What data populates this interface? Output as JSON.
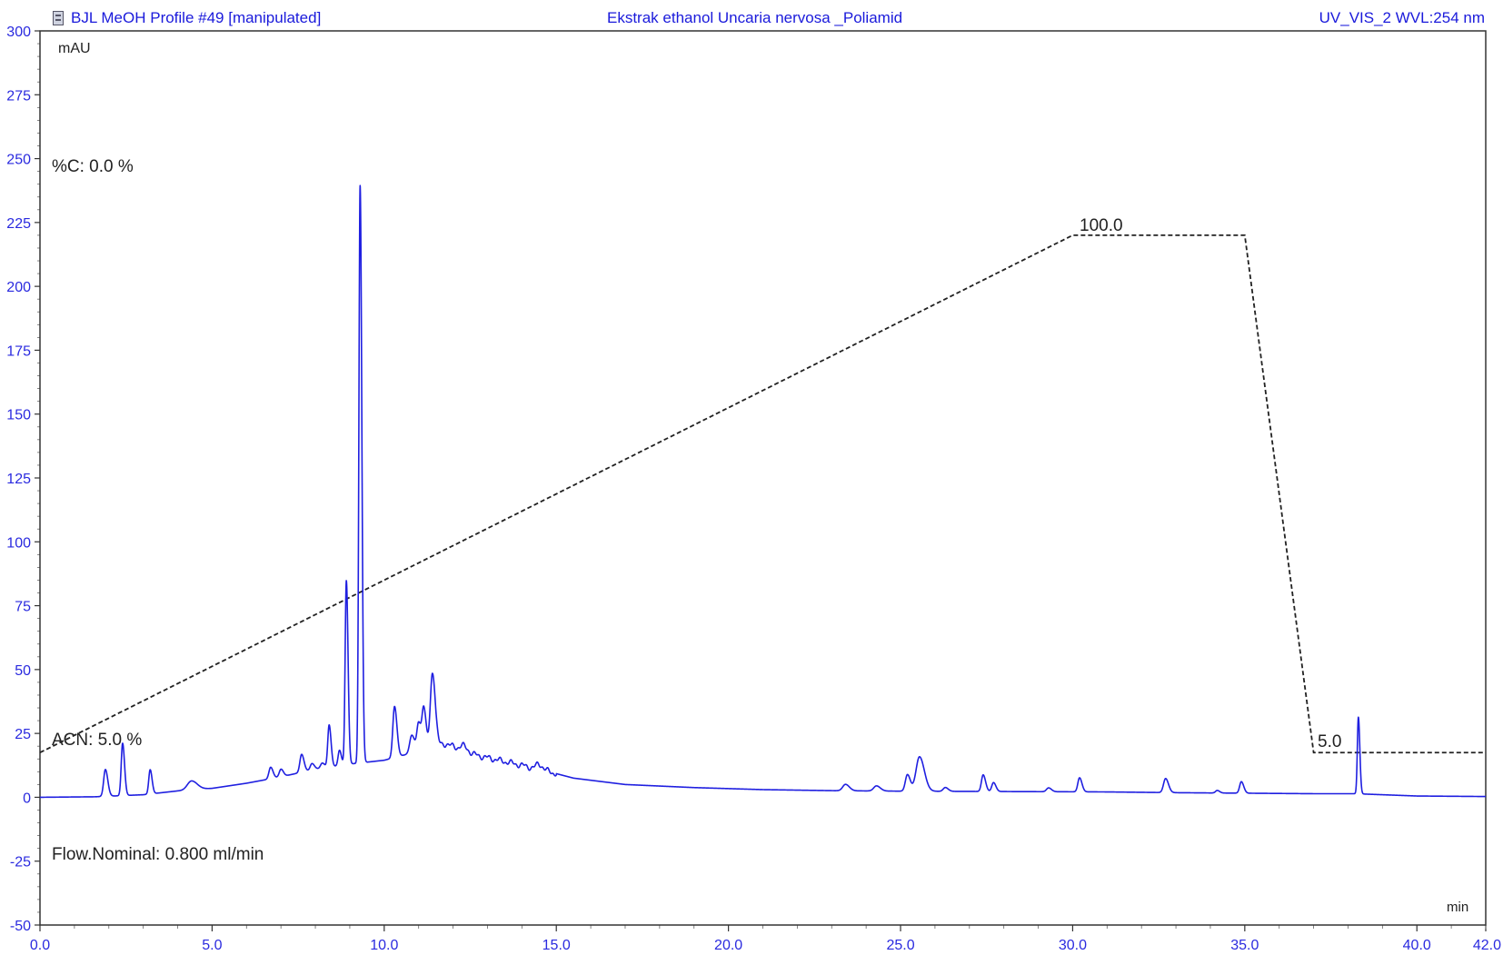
{
  "header": {
    "left": "BJL MeOH Profile #49 [manipulated]",
    "center": "Ekstrak ethanol Uncaria nervosa _Poliamid",
    "right": "UV_VIS_2 WVL:254 nm"
  },
  "annotations": {
    "y_unit": "mAU",
    "x_unit": "min",
    "percent_c": "%C: 0.0 %",
    "acn": "ACN: 5.0 %",
    "flow": "Flow.Nominal: 0.800 ml/min",
    "gradient_high_label": "100.0",
    "gradient_low_label": "5.0"
  },
  "chart_data": {
    "type": "line",
    "xlabel": "min",
    "ylabel": "mAU",
    "xlim": [
      0,
      42
    ],
    "ylim": [
      -50,
      300
    ],
    "x_ticks": [
      "0.0",
      "5.0",
      "10.0",
      "15.0",
      "20.0",
      "25.0",
      "30.0",
      "35.0",
      "40.0",
      "42.0"
    ],
    "x_tick_values": [
      0,
      5,
      10,
      15,
      20,
      25,
      30,
      35,
      40,
      42
    ],
    "y_ticks": [
      "-50",
      "-25",
      "0",
      "25",
      "50",
      "75",
      "100",
      "125",
      "150",
      "175",
      "200",
      "225",
      "250",
      "275",
      "300"
    ],
    "y_tick_values": [
      -50,
      -25,
      0,
      25,
      50,
      75,
      100,
      125,
      150,
      175,
      200,
      225,
      250,
      275,
      300
    ],
    "colors": {
      "chromatogram": "#1f1fe0",
      "gradient": "#222222",
      "axis": "#333333",
      "tick_label": "#2a2adf"
    },
    "series": [
      {
        "name": "UV_VIS_2 WVL:254 nm",
        "baseline": [
          [
            0,
            0
          ],
          [
            1.6,
            0.2
          ],
          [
            3.0,
            1.0
          ],
          [
            4.0,
            2.5
          ],
          [
            5.0,
            3.5
          ],
          [
            6.0,
            5.5
          ],
          [
            7.0,
            8.0
          ],
          [
            8.0,
            11.0
          ],
          [
            9.0,
            13.0
          ],
          [
            10.0,
            14.5
          ],
          [
            11.0,
            18.0
          ],
          [
            11.8,
            21.0
          ],
          [
            12.5,
            17.0
          ],
          [
            13.5,
            14.0
          ],
          [
            14.5,
            11.0
          ],
          [
            15.5,
            7.5
          ],
          [
            17.0,
            5.0
          ],
          [
            19.0,
            3.8
          ],
          [
            21.0,
            3.0
          ],
          [
            23.0,
            2.6
          ],
          [
            25.0,
            2.4
          ],
          [
            27.0,
            2.3
          ],
          [
            29.0,
            2.2
          ],
          [
            31.0,
            2.1
          ],
          [
            33.0,
            1.8
          ],
          [
            35.0,
            1.6
          ],
          [
            37.0,
            1.4
          ],
          [
            38.2,
            1.4
          ],
          [
            39.0,
            1.0
          ],
          [
            40.0,
            0.5
          ],
          [
            42.0,
            0.3
          ]
        ],
        "peaks": [
          {
            "rt": 1.9,
            "height": 10.5,
            "width": 0.05
          },
          {
            "rt": 2.4,
            "height": 20.5,
            "width": 0.04
          },
          {
            "rt": 3.2,
            "height": 9.5,
            "width": 0.04
          },
          {
            "rt": 4.4,
            "height": 3.5,
            "width": 0.12
          },
          {
            "rt": 6.7,
            "height": 4.5,
            "width": 0.05
          },
          {
            "rt": 7.0,
            "height": 3.0,
            "width": 0.05
          },
          {
            "rt": 7.6,
            "height": 7.0,
            "width": 0.05
          },
          {
            "rt": 7.9,
            "height": 2.5,
            "width": 0.05
          },
          {
            "rt": 8.2,
            "height": 2.0,
            "width": 0.05
          },
          {
            "rt": 8.4,
            "height": 16.5,
            "width": 0.04
          },
          {
            "rt": 8.7,
            "height": 6.0,
            "width": 0.04
          },
          {
            "rt": 8.9,
            "height": 72.0,
            "width": 0.035
          },
          {
            "rt": 9.3,
            "height": 226.0,
            "width": 0.035
          },
          {
            "rt": 10.3,
            "height": 20.0,
            "width": 0.05
          },
          {
            "rt": 10.8,
            "height": 7.0,
            "width": 0.06
          },
          {
            "rt": 11.0,
            "height": 11.0,
            "width": 0.05
          },
          {
            "rt": 11.15,
            "height": 16.0,
            "width": 0.05
          },
          {
            "rt": 11.4,
            "height": 29.0,
            "width": 0.06
          },
          {
            "rt": 12.3,
            "height": 2.0,
            "width": 0.1
          },
          {
            "rt": 14.5,
            "height": 2.0,
            "width": 0.08
          },
          {
            "rt": 23.4,
            "height": 2.5,
            "width": 0.08
          },
          {
            "rt": 24.3,
            "height": 2.0,
            "width": 0.08
          },
          {
            "rt": 25.2,
            "height": 6.5,
            "width": 0.06
          },
          {
            "rt": 25.55,
            "height": 13.5,
            "width": 0.1
          },
          {
            "rt": 26.3,
            "height": 1.5,
            "width": 0.06
          },
          {
            "rt": 27.4,
            "height": 6.5,
            "width": 0.05
          },
          {
            "rt": 27.7,
            "height": 3.5,
            "width": 0.05
          },
          {
            "rt": 29.3,
            "height": 1.5,
            "width": 0.06
          },
          {
            "rt": 30.2,
            "height": 5.5,
            "width": 0.05
          },
          {
            "rt": 32.7,
            "height": 5.5,
            "width": 0.06
          },
          {
            "rt": 34.2,
            "height": 1.0,
            "width": 0.05
          },
          {
            "rt": 34.9,
            "height": 4.5,
            "width": 0.05
          },
          {
            "rt": 38.3,
            "height": 30.0,
            "width": 0.03
          }
        ]
      }
    ],
    "gradient": {
      "line_style": "dashed",
      "points": [
        [
          0,
          5.0
        ],
        [
          30.0,
          100.0
        ],
        [
          35.0,
          100.0
        ],
        [
          37.0,
          5.0
        ],
        [
          42.0,
          5.0
        ]
      ]
    }
  }
}
